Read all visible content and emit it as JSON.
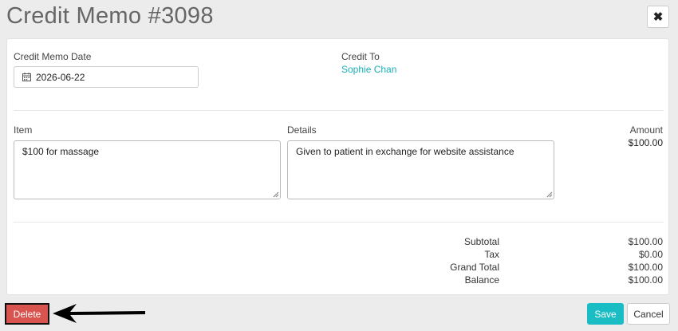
{
  "header": {
    "title": "Credit Memo #3098",
    "close_glyph": "✖"
  },
  "form": {
    "date_label": "Credit Memo Date",
    "date_value": "2026-06-22",
    "credit_to_label": "Credit To",
    "credit_to_name": "Sophie Chan"
  },
  "line_item": {
    "item_label": "Item",
    "item_value": "$100 for massage",
    "details_label": "Details",
    "details_value": "Given to patient in exchange for website assistance",
    "amount_label": "Amount",
    "amount_value": "$100.00"
  },
  "summary": {
    "subtotal_label": "Subtotal",
    "subtotal_value": "$100.00",
    "tax_label": "Tax",
    "tax_value": "$0.00",
    "grand_total_label": "Grand Total",
    "grand_total_value": "$100.00",
    "balance_label": "Balance",
    "balance_value": "$100.00"
  },
  "footer": {
    "delete_label": "Delete",
    "save_label": "Save",
    "cancel_label": "Cancel"
  },
  "colors": {
    "accent": "#1bbdc4",
    "danger": "#d9534f",
    "link": "#1aaeb8"
  },
  "icons": [
    "calendar-icon",
    "close-icon",
    "resize-handle-icon",
    "arrow-left-icon"
  ]
}
